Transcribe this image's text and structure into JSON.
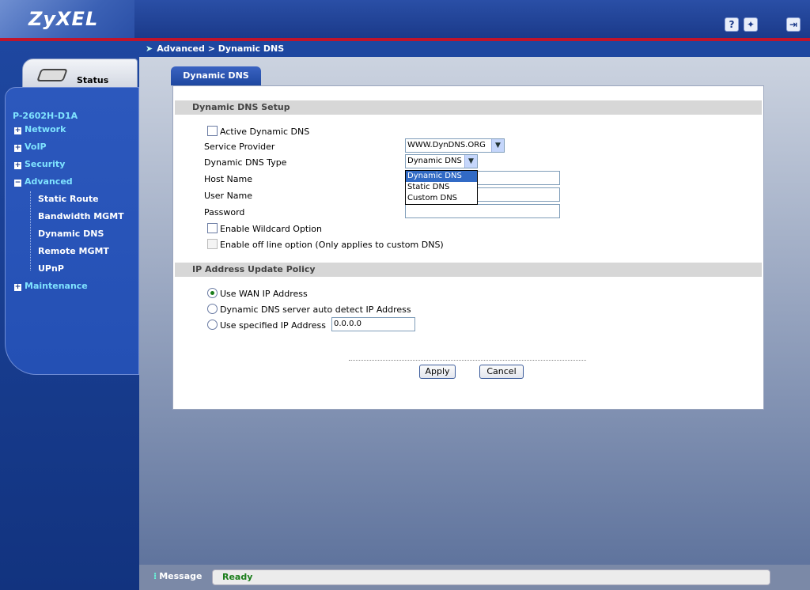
{
  "header": {
    "logo": "ZyXEL",
    "help_icon": "?",
    "wizard_icon": "wand-icon",
    "logout_icon": "logout-icon"
  },
  "sidebar": {
    "status_label": "Status",
    "model": "P-2602H-D1A",
    "menu": [
      {
        "label": "Network"
      },
      {
        "label": "VoIP"
      },
      {
        "label": "Security"
      },
      {
        "label": "Advanced"
      },
      {
        "label": "Maintenance"
      }
    ],
    "advanced_items": [
      {
        "label": "Static Route"
      },
      {
        "label": "Bandwidth MGMT"
      },
      {
        "label": "Dynamic DNS"
      },
      {
        "label": "Remote MGMT"
      },
      {
        "label": "UPnP"
      }
    ]
  },
  "breadcrumb": "Advanced > Dynamic DNS",
  "tab": "Dynamic DNS",
  "setup": {
    "heading": "Dynamic DNS Setup",
    "active_label": "Active Dynamic DNS",
    "service_provider_label": "Service Provider",
    "service_provider_value": "WWW.DynDNS.ORG",
    "type_label": "Dynamic DNS Type",
    "type_value": "Dynamic DNS",
    "type_options": [
      "Dynamic DNS",
      "Static DNS",
      "Custom DNS"
    ],
    "host_label": "Host Name",
    "user_label": "User Name",
    "password_label": "Password",
    "wildcard_label": "Enable Wildcard Option",
    "offline_label": "Enable off line option (Only applies to custom DNS)"
  },
  "policy": {
    "heading": "IP Address Update Policy",
    "wan_label": "Use WAN IP Address",
    "auto_label": "Dynamic DNS server auto detect IP Address",
    "specified_label": "Use specified IP Address",
    "specified_value": "0.0.0.0"
  },
  "buttons": {
    "apply": "Apply",
    "cancel": "Cancel"
  },
  "statusbar": {
    "label": "Message",
    "value": "Ready"
  },
  "colors": {
    "brand_blue": "#1e47a0",
    "accent_red": "#c0142b",
    "menu_text": "#7fe3ff",
    "ready_green": "#1a7d1a"
  }
}
